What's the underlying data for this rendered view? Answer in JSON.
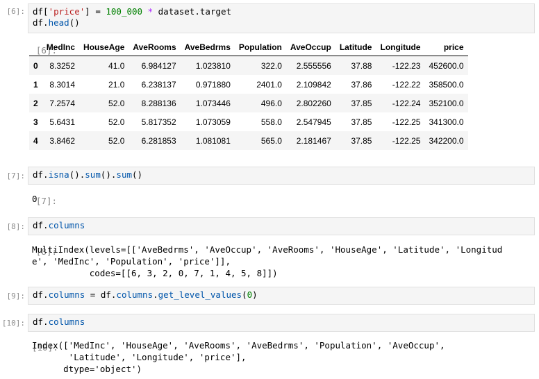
{
  "cells": [
    {
      "prompt_in": "[6]:",
      "code_lines": [
        [
          [
            "df[",
            ""
          ],
          [
            "'price'",
            "s"
          ],
          [
            "] = ",
            ""
          ],
          [
            "100_000",
            "n"
          ],
          [
            " ",
            ""
          ],
          [
            "*",
            "k"
          ],
          [
            " dataset.target",
            ""
          ]
        ],
        [
          [
            "df.",
            ""
          ],
          [
            "head",
            "f"
          ],
          [
            "()",
            ""
          ]
        ]
      ]
    },
    {
      "prompt_out": "[6]:"
    },
    {
      "prompt_in": "[7]:",
      "code_lines": [
        [
          [
            "df.",
            ""
          ],
          [
            "isna",
            "f"
          ],
          [
            "().",
            ""
          ],
          [
            "sum",
            "f"
          ],
          [
            "().",
            ""
          ],
          [
            "sum",
            "f"
          ],
          [
            "()",
            ""
          ]
        ]
      ]
    },
    {
      "prompt_out": "[7]:",
      "output": "0"
    },
    {
      "prompt_in": "[8]:",
      "code_lines": [
        [
          [
            "df.",
            ""
          ],
          [
            "columns",
            "a"
          ]
        ]
      ]
    },
    {
      "prompt_out": "[8]:",
      "output": "MultiIndex(levels=[['AveBedrms', 'AveOccup', 'AveRooms', 'HouseAge', 'Latitude', 'Longitud\ne', 'MedInc', 'Population', 'price']],\n           codes=[[6, 3, 2, 0, 7, 1, 4, 5, 8]])"
    },
    {
      "prompt_in": "[9]:",
      "code_lines": [
        [
          [
            "df.",
            ""
          ],
          [
            "columns",
            "a"
          ],
          [
            " = df.",
            ""
          ],
          [
            "columns",
            "a"
          ],
          [
            ".",
            ""
          ],
          [
            "get_level_values",
            "f"
          ],
          [
            "(",
            ""
          ],
          [
            "0",
            "n"
          ],
          [
            ")",
            ""
          ]
        ]
      ]
    },
    {
      "prompt_in": "[10]:",
      "code_lines": [
        [
          [
            "df.",
            ""
          ],
          [
            "columns",
            "a"
          ]
        ]
      ]
    },
    {
      "prompt_out": "[10]:",
      "output": "Index(['MedInc', 'HouseAge', 'AveRooms', 'AveBedrms', 'Population', 'AveOccup',\n       'Latitude', 'Longitude', 'price'],\n      dtype='object')"
    }
  ],
  "table": {
    "columns": [
      "",
      "MedInc",
      "HouseAge",
      "AveRooms",
      "AveBedrms",
      "Population",
      "AveOccup",
      "Latitude",
      "Longitude",
      "price"
    ],
    "rows": [
      [
        "0",
        "8.3252",
        "41.0",
        "6.984127",
        "1.023810",
        "322.0",
        "2.555556",
        "37.88",
        "-122.23",
        "452600.0"
      ],
      [
        "1",
        "8.3014",
        "21.0",
        "6.238137",
        "0.971880",
        "2401.0",
        "2.109842",
        "37.86",
        "-122.22",
        "358500.0"
      ],
      [
        "2",
        "7.2574",
        "52.0",
        "8.288136",
        "1.073446",
        "496.0",
        "2.802260",
        "37.85",
        "-122.24",
        "352100.0"
      ],
      [
        "3",
        "5.6431",
        "52.0",
        "5.817352",
        "1.073059",
        "558.0",
        "2.547945",
        "37.85",
        "-122.25",
        "341300.0"
      ],
      [
        "4",
        "3.8462",
        "52.0",
        "6.281853",
        "1.081081",
        "565.0",
        "2.181467",
        "37.85",
        "-122.25",
        "342200.0"
      ]
    ]
  }
}
